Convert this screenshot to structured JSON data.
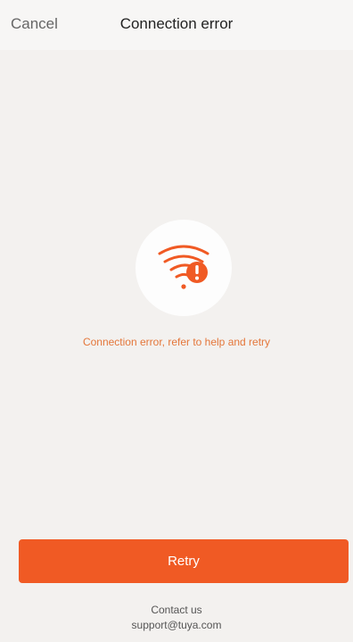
{
  "header": {
    "cancel_label": "Cancel",
    "title": "Connection error"
  },
  "status": {
    "icon": "wifi-error-icon",
    "message": "Connection error, refer to help and retry"
  },
  "actions": {
    "retry_label": "Retry"
  },
  "contact": {
    "label": "Contact us",
    "email": "support@tuya.com"
  },
  "colors": {
    "accent": "#f05a24",
    "message": "#e4773b",
    "background": "#f3f1ef"
  }
}
